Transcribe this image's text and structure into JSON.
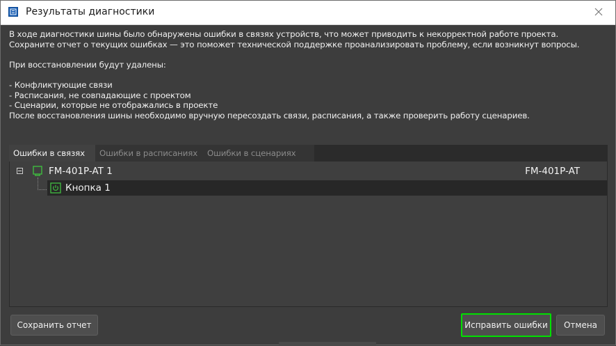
{
  "window": {
    "title": "Результаты диагностики"
  },
  "message": {
    "line1": "В ходе диагностики шины было обнаружены ошибки в связях устройств, что может приводить к некорректной работе проекта.",
    "line2": "Сохраните отчет о текущих ошибках — это поможет технической поддержке проанализировать проблему, если возникнут вопросы.",
    "line3": "При восстановлении будут удалены:",
    "item1": "- Конфликтующие связи",
    "item2": "- Расписания, не совпадающие с проектом",
    "item3": "- Сценарии, которые не отображались в проекте",
    "line4": "После восстановления шины необходимо вручную пересоздать связи, расписания, а также проверить работу сценариев."
  },
  "tabs": [
    {
      "label": "Ошибки в связях",
      "active": true
    },
    {
      "label": "Ошибки в расписаниях",
      "active": false
    },
    {
      "label": "Ошибки в сценариях",
      "active": false
    }
  ],
  "tree": {
    "device": {
      "name": "FM-401P-AT 1",
      "model": "FM-401P-AT",
      "icon": "device-icon",
      "expanded": true,
      "children": [
        {
          "name": "Кнопка 1",
          "icon": "power-button-icon",
          "selected": true
        }
      ]
    }
  },
  "buttons": {
    "save": "Сохранить отчет",
    "fix": "Исправить ошибки",
    "cancel": "Отмена"
  },
  "colors": {
    "accent_green": "#00e000",
    "icon_green": "#3fb43f",
    "title_icon_blue": "#1a5fb4"
  }
}
